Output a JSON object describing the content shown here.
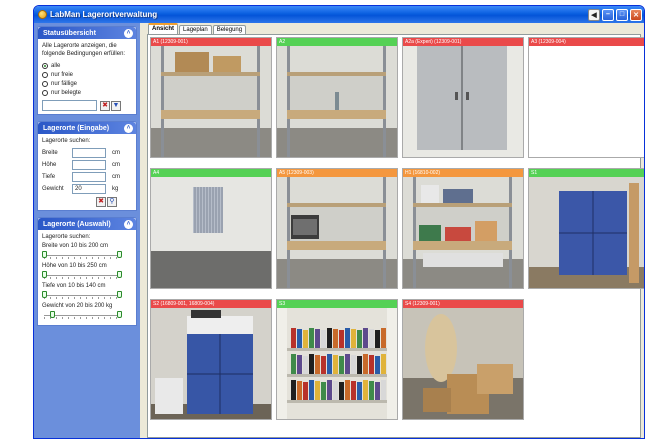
{
  "window": {
    "title": "LabMan Lagerortverwaltung"
  },
  "status_panel": {
    "title": "Statusübersicht",
    "description": "Alle Lagerorte anzeigen, die folgende Bedingungen erfüllen:",
    "options": [
      "alle",
      "nur freie",
      "nur fällige",
      "nur belegte"
    ],
    "selected": "alle"
  },
  "input_panel": {
    "title": "Lagerorte (Eingabe)",
    "search_label": "Lagerorte suchen:",
    "fields": [
      {
        "label": "Breite",
        "value": "",
        "unit": "cm"
      },
      {
        "label": "Höhe",
        "value": "",
        "unit": "cm"
      },
      {
        "label": "Tiefe",
        "value": "",
        "unit": "cm"
      },
      {
        "label": "Gewicht",
        "value": "20",
        "unit": "kg"
      }
    ]
  },
  "select_panel": {
    "title": "Lagerorte (Auswahl)",
    "search_label": "Lagerorte suchen:",
    "sliders": [
      {
        "label": "Breite von 10 bis 200 cm",
        "low": 10,
        "high": 200,
        "min": 10,
        "max": 200
      },
      {
        "label": "Höhe von 10 bis 250 cm",
        "low": 10,
        "high": 250,
        "min": 10,
        "max": 250
      },
      {
        "label": "Tiefe von 10 bis 140 cm",
        "low": 10,
        "high": 140,
        "min": 10,
        "max": 140
      },
      {
        "label": "Gewicht von 20 bis 200 kg",
        "low": 20,
        "high": 200,
        "min": 0,
        "max": 200
      }
    ]
  },
  "tabs": [
    {
      "label": "Ansicht",
      "active": true
    },
    {
      "label": "Lageplan",
      "active": false
    },
    {
      "label": "Belegung",
      "active": false
    }
  ],
  "tiles": [
    {
      "label": "A1 (12309-001)",
      "status": "red",
      "scene": "shelf-boxes"
    },
    {
      "label": "A2",
      "status": "green",
      "scene": "shelf-empty"
    },
    {
      "label": "A2a (Experi) (12309-001)",
      "status": "red",
      "scene": "cabinet-grey"
    },
    {
      "label": "A3 (12309-004)",
      "status": "red",
      "scene": "blank"
    },
    {
      "label": "A4",
      "status": "green",
      "scene": "room"
    },
    {
      "label": "A5 (12309-003)",
      "status": "orange",
      "scene": "shelf-device"
    },
    {
      "label": "H1 (16810-002)",
      "status": "orange",
      "scene": "shelf-full"
    },
    {
      "label": "S1",
      "status": "green",
      "scene": "cabinet-blue"
    },
    {
      "label": "S2 (16809-001, 16809-004)",
      "status": "red",
      "scene": "cabinet-blue-stacked"
    },
    {
      "label": "S3",
      "status": "green",
      "scene": "bookshelf"
    },
    {
      "label": "S4 (12309-001)",
      "status": "red",
      "scene": "boxes-floor"
    }
  ]
}
